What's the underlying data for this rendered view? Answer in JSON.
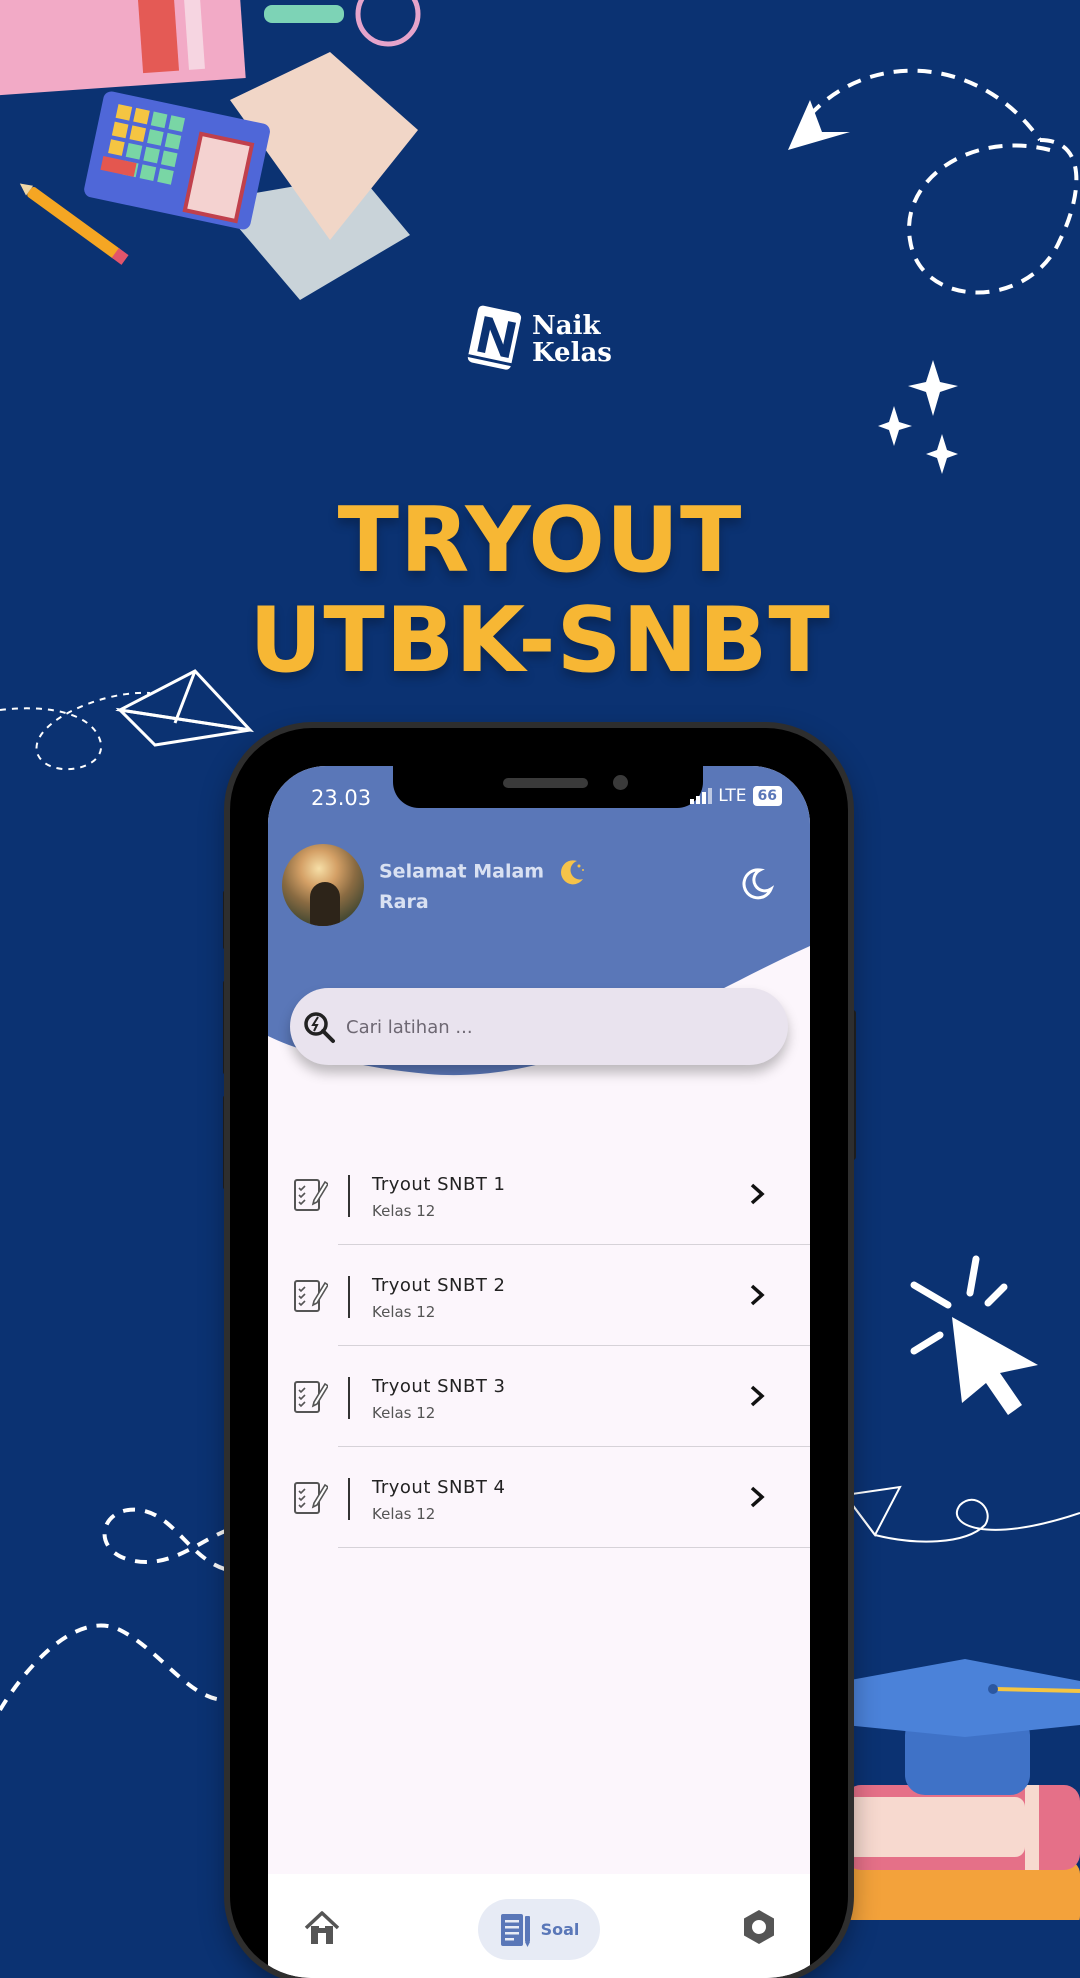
{
  "brand": {
    "logo_line1": "Naik",
    "logo_line2": "Kelas"
  },
  "headline": {
    "line1": "TRYOUT",
    "line2": "UTBK-SNBT"
  },
  "status_bar": {
    "time": "23.03",
    "network": "LTE",
    "battery": "66"
  },
  "header": {
    "greeting": "Selamat Malam",
    "user_name": "Rara",
    "theme_icon": "moon-icon"
  },
  "search": {
    "placeholder": "Cari latihan ...",
    "value": ""
  },
  "list": {
    "items": [
      {
        "title": "Tryout SNBT 1",
        "subtitle": "Kelas 12"
      },
      {
        "title": "Tryout SNBT 2",
        "subtitle": "Kelas 12"
      },
      {
        "title": "Tryout SNBT 3",
        "subtitle": "Kelas 12"
      },
      {
        "title": "Tryout SNBT 4",
        "subtitle": "Kelas 12"
      }
    ]
  },
  "bottom_nav": {
    "home_icon": "home-icon",
    "soal_label": "Soal",
    "settings_icon": "settings-icon"
  },
  "colors": {
    "background": "#0b3272",
    "headline": "#f7b734",
    "header": "#5a77b8",
    "screen": "#fcf6fc"
  }
}
